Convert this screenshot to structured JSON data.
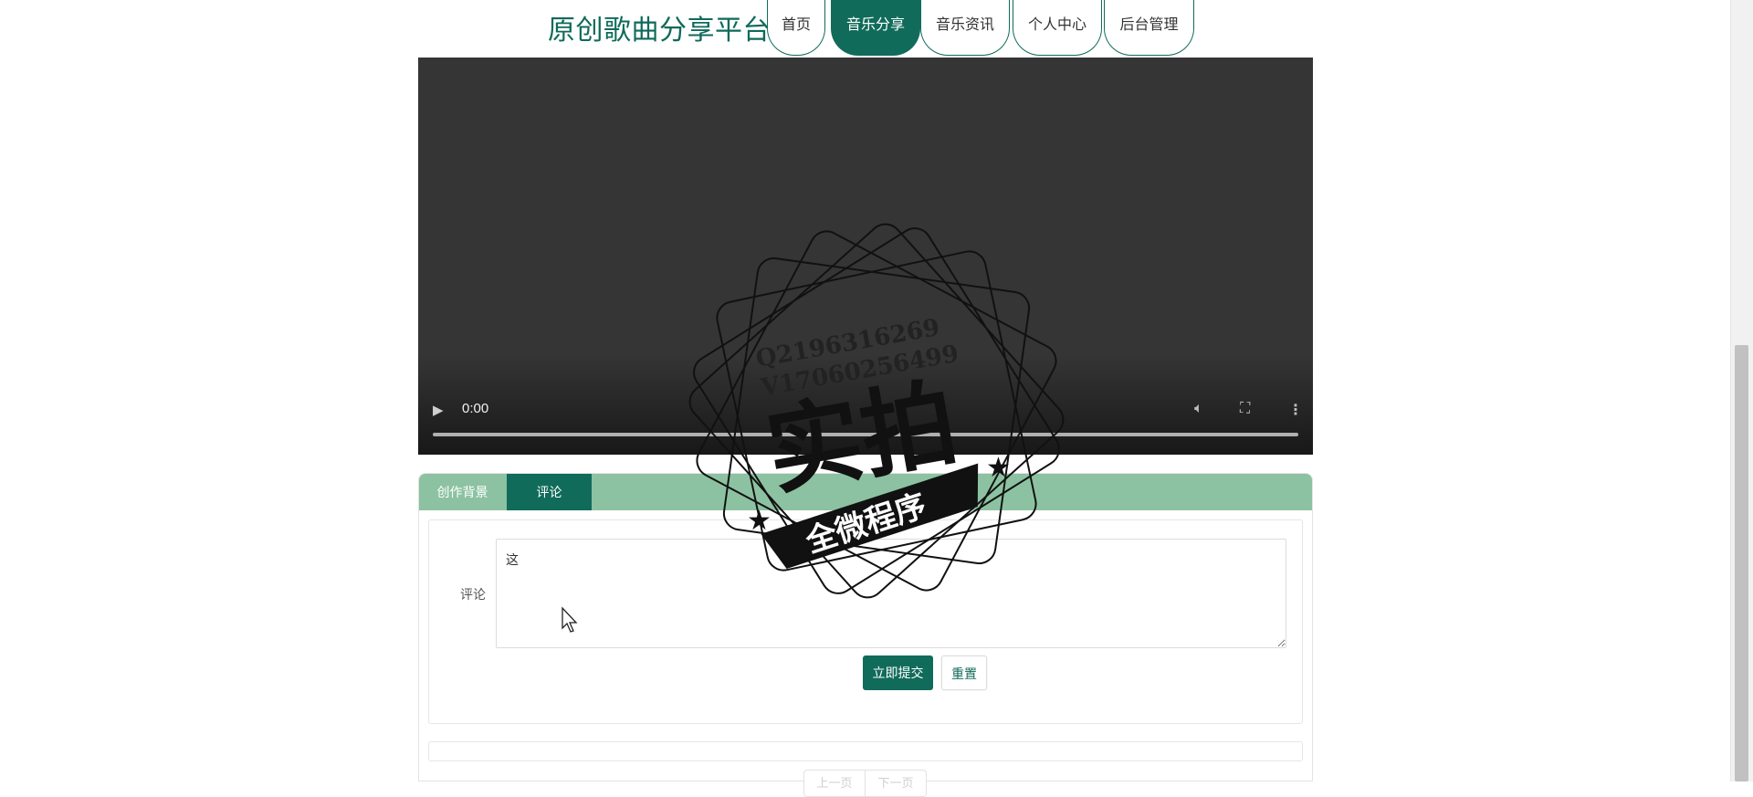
{
  "header": {
    "site_title": "原创歌曲分享平台",
    "nav": [
      {
        "label": "首页"
      },
      {
        "label": "音乐分享"
      },
      {
        "label": "音乐资讯"
      },
      {
        "label": "个人中心"
      },
      {
        "label": "后台管理"
      }
    ],
    "active_nav": "音乐分享",
    "accent_color": "#116b5a"
  },
  "video": {
    "play_icon": "play-icon",
    "current_time": "0:00",
    "progress": 0,
    "controls": [
      "volume-icon",
      "fullscreen-icon",
      "more-vertical-icon"
    ]
  },
  "tabs": {
    "items": [
      {
        "label": "创作背景"
      },
      {
        "label": "评论"
      }
    ],
    "active": "评论",
    "bar_color": "#8cc2a1"
  },
  "comment_form": {
    "label": "评论",
    "textarea_value": "这",
    "submit_label": "立即提交",
    "reset_label": "重置"
  },
  "pagination": {
    "prev_label": "上一页",
    "next_label": "下一页"
  },
  "watermark": {
    "line1": "Q2196316269",
    "line2": "V17060256499",
    "big_text": "实拍",
    "banner_text": "全微程序"
  }
}
